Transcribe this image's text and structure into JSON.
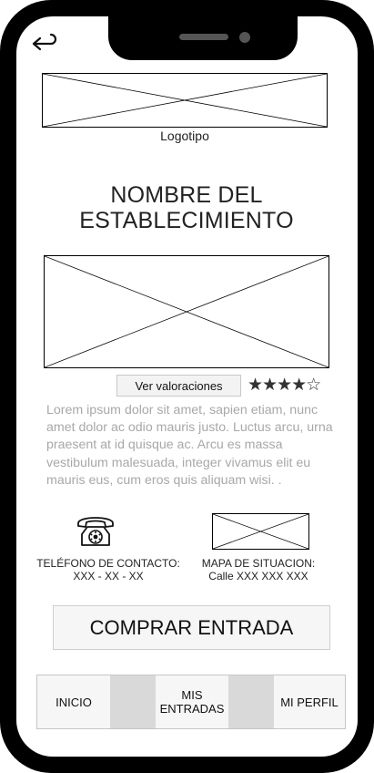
{
  "header": {
    "back_icon": "back-arrow-icon"
  },
  "logo": {
    "caption": "Logotipo"
  },
  "venue": {
    "title_line1": "NOMBRE DEL",
    "title_line2": "ESTABLECIMIENTO"
  },
  "reviews": {
    "button_label": "Ver valoraciones",
    "rating": 4,
    "max_rating": 5,
    "stars_filled": "★★★★",
    "stars_empty": "☆"
  },
  "description": "Lorem ipsum dolor sit amet, sapien etiam, nunc amet dolor ac odio mauris justo. Luctus arcu, urna praesent at id quisque ac. Arcu es massa vestibulum malesuada, integer vivamus elit eu mauris eus, cum eros quis aliquam wisi. .",
  "contact": {
    "icon": "telephone-icon",
    "label": "TELÉFONO DE CONTACTO:",
    "value": "XXX - XX - XX"
  },
  "map": {
    "label": "MAPA DE SITUACION:",
    "value": "Calle XXX XXX XXX"
  },
  "cta": {
    "label": "COMPRAR ENTRADA"
  },
  "navbar": {
    "items": [
      {
        "label_line1": "INICIO",
        "label_line2": ""
      },
      {
        "label_line1": "MIS",
        "label_line2": "ENTRADAS"
      },
      {
        "label_line1": "MI PERFIL",
        "label_line2": ""
      }
    ]
  }
}
